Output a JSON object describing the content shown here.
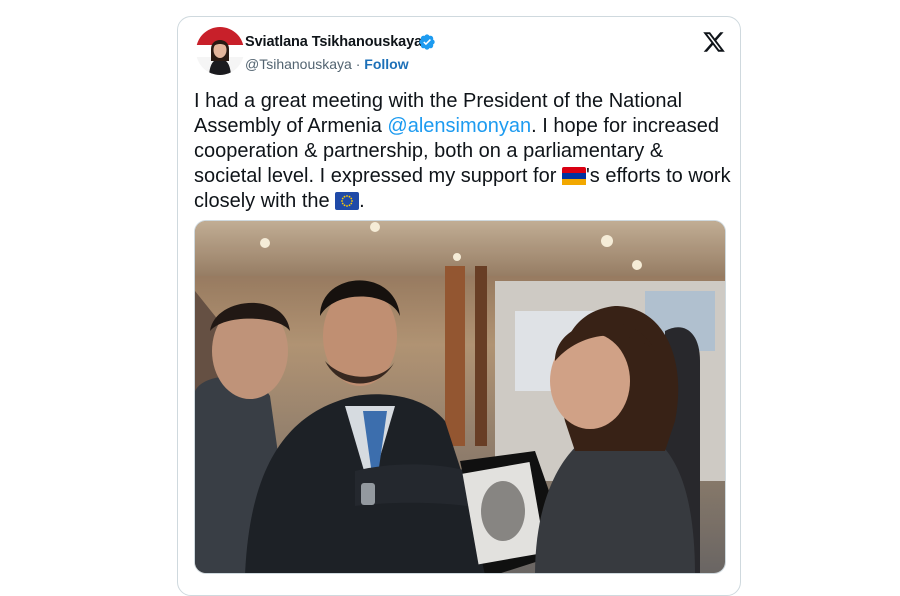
{
  "tweet": {
    "author": {
      "display_name": "Sviatlana Tsikhanouskaya",
      "handle": "@Tsihanouskaya",
      "separator": "·",
      "follow_label": "Follow",
      "verified": true,
      "avatar_icon": "profile-photo"
    },
    "platform_icon": "x-logo-icon",
    "text": {
      "part1": "I had a great meeting with the President of the National Assembly of Armenia ",
      "mention": "@alensimonyan",
      "part2": ". I hope for increased cooperation & partnership, both on a parliamentary & societal level. I expressed my support for ",
      "flag1": "armenia-flag",
      "part3": "'s efforts to work closely with the ",
      "flag2": "eu-flag",
      "part4": "."
    },
    "media_alt": "photo"
  },
  "colors": {
    "link": "#1d9bf0",
    "follow": "#1d70b8",
    "verified": "#1d9bf0",
    "secondary_text": "#536471",
    "border": "#cfd9de"
  }
}
